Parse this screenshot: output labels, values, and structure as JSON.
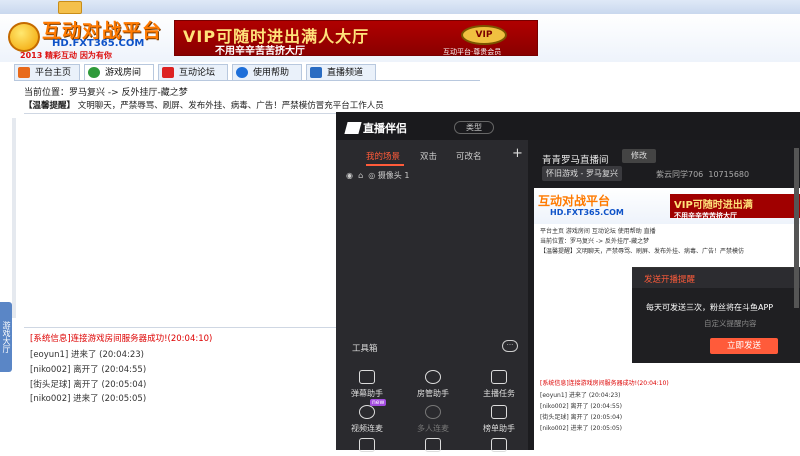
{
  "banner": {
    "logo_title": "互动对战平台",
    "logo_url": "HD.FXT365.COM",
    "logo_slogan": "2013 精彩互动 因为有你",
    "vip_headline": "VIP可随时进出满人大厅",
    "vip_subline": "不用辛辛苦苦挤大厅",
    "vip_badge": "VIP",
    "vip_caption": "互动平台·尊贵会员"
  },
  "nav": {
    "tabs": [
      {
        "label": "平台主页",
        "icon": "home-icon"
      },
      {
        "label": "游戏房间",
        "icon": "game-room-icon"
      },
      {
        "label": "互动论坛",
        "icon": "forum-icon"
      },
      {
        "label": "使用帮助",
        "icon": "help-icon"
      },
      {
        "label": "直播频道",
        "icon": "live-channel-icon"
      }
    ]
  },
  "breadcrumb": {
    "prefix": "当前位置：",
    "path": "罗马复兴 -> 反外挂厅-藏之梦"
  },
  "notice": {
    "head": "【温馨提醒】",
    "body": "文明聊天，严禁辱骂、刷屏、发布外挂、病毒、广告！严禁模仿冒充平台工作人员"
  },
  "side_tab": {
    "label": "游戏大厅"
  },
  "log": [
    {
      "text": "[系统信息]连接游戏房间服务器成功!(20:04:10)",
      "sys": true
    },
    {
      "text": "[eoyun1] 进来了 (20:04:23)",
      "sys": false
    },
    {
      "text": "[niko002] 离开了 (20:04:55)",
      "sys": false
    },
    {
      "text": "[街头足球] 离开了 (20:05:04)",
      "sys": false
    },
    {
      "text": "[niko002] 进来了 (20:05:05)",
      "sys": false
    }
  ],
  "stream": {
    "app_name": "直播伴侣",
    "type_button": "类型",
    "tabs": {
      "scenes": "我的场景",
      "duo": "双击",
      "rename": "可改名"
    },
    "add": "+",
    "source": "摄像头 1",
    "tools_title": "工具箱",
    "tools_more": "···",
    "tools": [
      {
        "label": "弹幕助手",
        "icon": "danmaku-icon",
        "dim": false
      },
      {
        "label": "房管助手",
        "icon": "room-admin-icon",
        "dim": false
      },
      {
        "label": "主播任务",
        "icon": "task-icon",
        "dim": false
      },
      {
        "label": "视频连麦",
        "icon": "video-link-icon",
        "dim": false,
        "tag": "new"
      },
      {
        "label": "多人连麦",
        "icon": "multi-link-icon",
        "dim": true
      },
      {
        "label": "榜单助手",
        "icon": "ranking-icon",
        "dim": false
      },
      {
        "label": "",
        "icon": "screenshot-icon",
        "dim": false
      },
      {
        "label": "",
        "icon": "download-icon",
        "dim": false
      },
      {
        "label": "",
        "icon": "tv-icon",
        "dim": false
      }
    ],
    "room_title": "青青罗马直播间",
    "edit_button": "修改",
    "category": "怀旧游戏 - 罗马复兴",
    "streamer": "紫云同学706",
    "room_id": "10715680"
  },
  "preview": {
    "logo_title": "互动对战平台",
    "logo_url": "HD.FXT365.COM",
    "vip_headline": "VIP可随时进出满",
    "vip_subline": "不用辛辛苦苦挤大厅",
    "nav": "平台主页  游戏房间  互动论坛  使用帮助  直播",
    "crumb": "当前位置：罗马复兴 -> 反外挂厅-藏之梦",
    "notice": "【温馨提醒】文明聊天，严禁辱骂、刷屏、发布外挂、病毒、广告！严禁模仿",
    "log": [
      {
        "text": "[系统信息]连接游戏房间服务器成功!(20:04:10)",
        "sys": true
      },
      {
        "text": "[eoyun1] 进来了 (20:04:23)",
        "sys": false
      },
      {
        "text": "[niko002] 离开了 (20:04:55)",
        "sys": false
      },
      {
        "text": "[街头足球] 离开了 (20:05:04)",
        "sys": false
      },
      {
        "text": "[niko002] 进来了 (20:05:05)",
        "sys": false
      }
    ]
  },
  "popup": {
    "title": "发送开播提醒",
    "body": "每天可发送三次，粉丝将在斗鱼APP",
    "custom": "自定义提醒内容",
    "button": "立即发送"
  },
  "colors": {
    "accent": "#ff5b3a",
    "banner_red": "#a00000",
    "logo_orange": "#ff7a00"
  }
}
